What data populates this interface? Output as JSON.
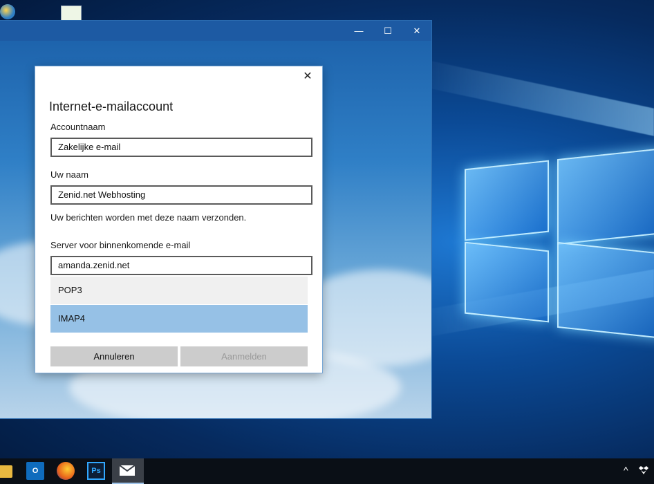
{
  "window": {
    "minimize_glyph": "—",
    "maximize_glyph": "☐",
    "close_glyph": "✕"
  },
  "dialog": {
    "close_glyph": "✕",
    "title": "Internet-e-mailaccount",
    "account_name_label": "Accountnaam",
    "account_name_value": "Zakelijke e-mail",
    "your_name_label": "Uw naam",
    "your_name_value": "Zenid.net Webhosting",
    "your_name_hint": "Uw berichten worden met deze naam verzonden.",
    "incoming_server_label": "Server voor binnenkomende e-mail",
    "incoming_server_value": "amanda.zenid.net",
    "server_type_options": [
      "POP3",
      "IMAP4"
    ],
    "server_type_selected": "IMAP4",
    "cancel_label": "Annuleren",
    "signin_label": "Aanmelden"
  },
  "taskbar": {
    "icons": [
      "file-explorer-icon",
      "outlook-icon",
      "firefox-icon",
      "photoshop-icon",
      "mail-icon"
    ],
    "outlook_text": "O",
    "photoshop_text": "Ps",
    "tray_chevron": "^"
  },
  "colors": {
    "selected_option": "#96c1e6",
    "hover_option": "#f0f0f0",
    "disabled_text": "#9a9a9a"
  }
}
